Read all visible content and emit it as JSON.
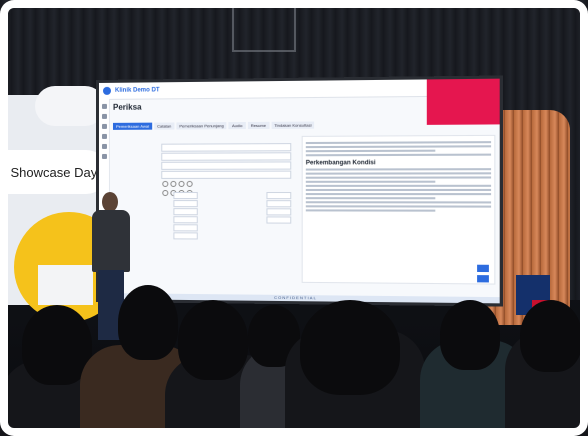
{
  "stage": {
    "showcase_text": "l Showcase Day"
  },
  "app": {
    "name": "Klinik Demo DT",
    "page_title": "Periksa",
    "tabs": [
      {
        "label": "Pemeriksaan Awal"
      },
      {
        "label": "Catatan"
      },
      {
        "label": "Pemeriksaan Penunjang"
      },
      {
        "label": "Audio"
      },
      {
        "label": "Resume"
      },
      {
        "label": "Tindakan Konsultasi"
      }
    ],
    "right_panel": {
      "heading": "Perkembangan Kondisi"
    },
    "footer": "CONFIDENTIAL"
  },
  "colors": {
    "accent": "#2d6cdf",
    "alert": "#e5164f",
    "stage_yellow": "#f5c21b"
  }
}
